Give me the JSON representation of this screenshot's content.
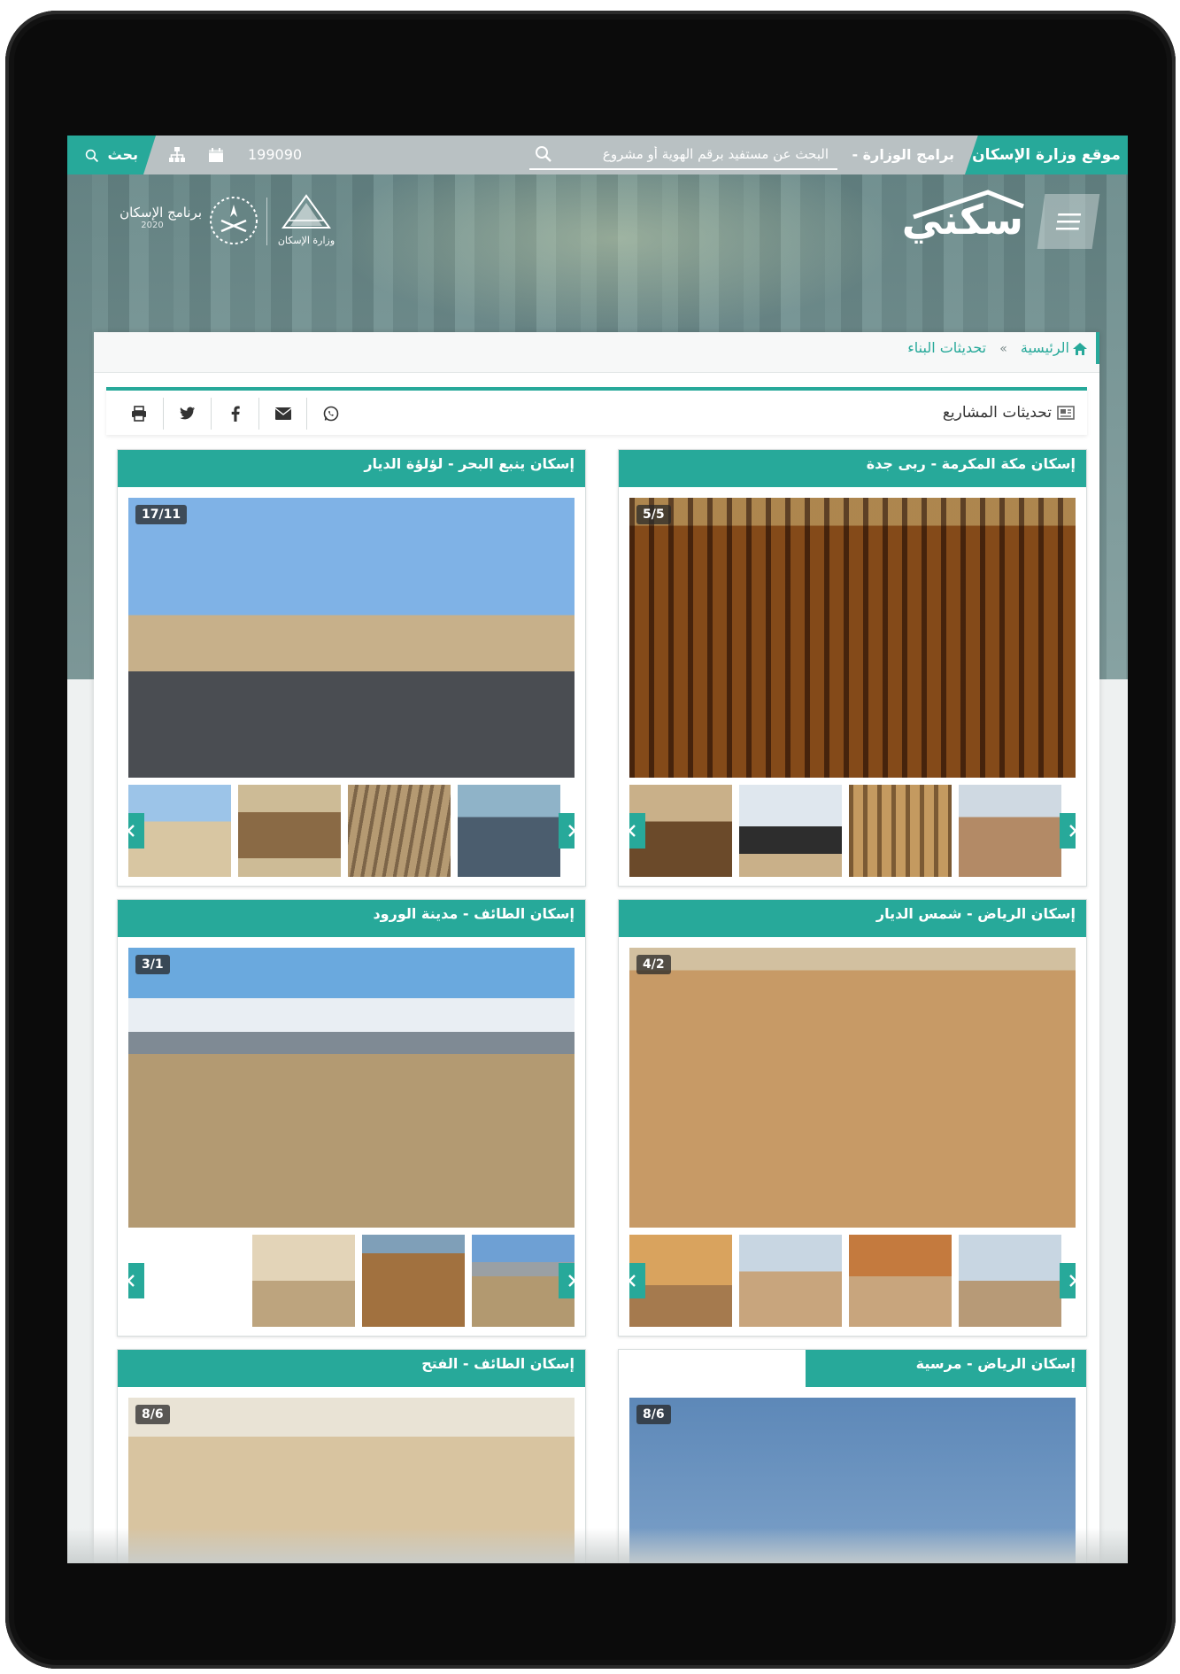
{
  "topbar": {
    "site_link": "موقع وزارة الإسكان",
    "programs_link": "برامج الوزارة -",
    "search_placeholder": "البحث عن مستفيد برقم الهوية أو مشروع",
    "visitor_count": "199090",
    "search_label": "بحث"
  },
  "header": {
    "logo_text": "سكني",
    "ministry_name": "وزارة الإسكان",
    "program_name": "برنامج الإسكان",
    "vision_year": "2020"
  },
  "breadcrumb": {
    "home": "الرئيسية",
    "separator": "»",
    "current": "تحديثات البناء"
  },
  "section": {
    "title": "تحديثات المشاريع"
  },
  "cards": [
    {
      "title": "إسكان مكة المكرمة - ربى جدة",
      "counter": "5/5"
    },
    {
      "title": "إسكان ينبع البحر - لؤلؤة الديار",
      "counter": "17/11"
    },
    {
      "title": "إسكان الرياض - شمس الديار",
      "counter": "4/2"
    },
    {
      "title": "إسكان الطائف - مدينة الورود",
      "counter": "3/1"
    },
    {
      "title": "إسكان الرياض - مرسية",
      "counter": "8/6"
    },
    {
      "title": "إسكان الطائف - الفتح",
      "counter": "8/6"
    }
  ],
  "colors": {
    "accent": "#27a99a",
    "topbar": "#b9c1c3"
  }
}
